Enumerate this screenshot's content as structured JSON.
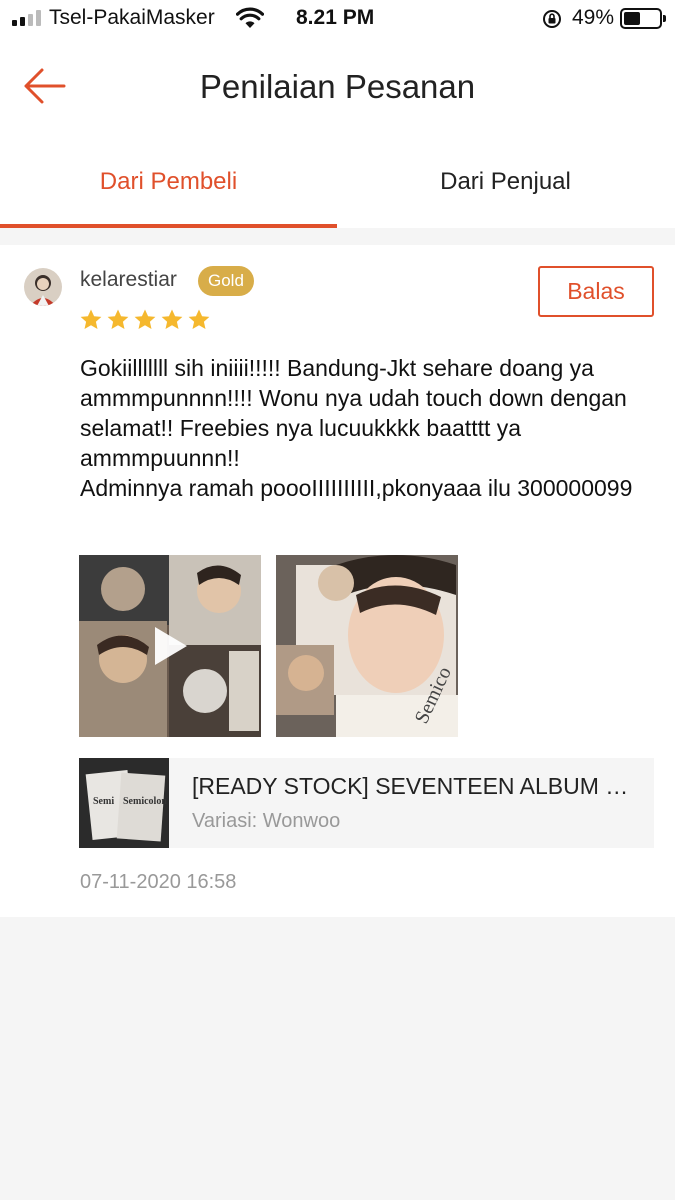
{
  "status_bar": {
    "carrier": "Tsel-PakaiMasker",
    "time": "8.21 PM",
    "battery_percent": "49%",
    "battery_level": 0.49,
    "signal_bars": 2
  },
  "header": {
    "title": "Penilaian Pesanan",
    "back_icon": "arrow-left-icon"
  },
  "tabs": [
    {
      "label": "Dari Pembeli",
      "active": true
    },
    {
      "label": "Dari Penjual",
      "active": false
    }
  ],
  "review": {
    "username": "kelarestiar",
    "badge": "Gold",
    "reply_label": "Balas",
    "rating": 5,
    "max_rating": 5,
    "text": "Gokiilllllll sih iniiii!!!!! Bandung-Jkt sehare doang ya ammmpunnnn!!!! Wonu nya udah touch down dengan selamat!! Freebies nya lucuukkkk baatttt ya ammmpuunnn!!\nAdminnya ramah poooIIIIIIIIII,pkonyaaa ilu 300000099",
    "media": [
      {
        "type": "video",
        "icon": "play-icon"
      },
      {
        "type": "photo"
      }
    ],
    "product": {
      "name": "[READY STOCK] SEVENTEEN ALBUM SEMICOLON",
      "variant": "Variasi: Wonwoo"
    },
    "date": "07-11-2020 16:58"
  },
  "colors": {
    "accent": "#e0502b",
    "gold_badge": "#d8ad49",
    "star": "#f5b82e",
    "background": "#f5f5f5"
  }
}
